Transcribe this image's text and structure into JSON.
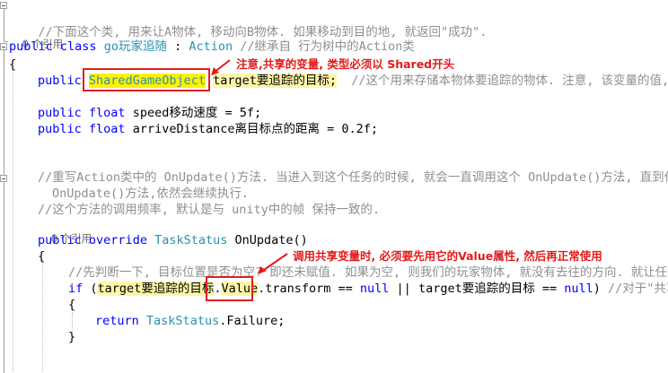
{
  "colors": {
    "keyword": "#0000ff",
    "type": "#2b91af",
    "comment": "#8f8f8f",
    "annotation": "#e21b1b",
    "highlight": "#fff6a8"
  },
  "code": {
    "l1_comment": "//下面这个类, 用来让A物体, 移动向B物体. 如果移动到目的地, 就返回\"成功\".",
    "l2_refs": "0 个引用",
    "l3_public": "public",
    "l3_class": "class",
    "l3_name": "go玩家追随",
    "l3_colon": " : ",
    "l3_base": "Action",
    "l3_comment": "//继承自 行为树中的Action类",
    "l4_brace": "{",
    "l5_public": "public",
    "l5_type": "SharedGameObject",
    "l5_var": "target要追踪的目标;",
    "l5_comment": "//这个用来存储本物体要追踪的物体. 注意, 该变量的值, 会",
    "l6_public": "public",
    "l6_float": "float",
    "l6_rest": "speed移动速度 = 5f;",
    "l7_public": "public",
    "l7_float": "float",
    "l7_rest": "arriveDistance离目标点的距离 = 0.2f;",
    "l8_comment": "//重写Action类中的 OnUpdate()方法. 当进入到这个任务的时候, 就会一直调用这个 OnUpdate()方法, 直到任务",
    "l9_comment": "OnUpdate()方法,依然会继续执行.",
    "l10_comment": "//这个方法的调用频率, 默认是与 unity中的帧 保持一致的.",
    "l11_refs": "0 个引用",
    "l12_public": "public",
    "l12_override": "override",
    "l12_type": "TaskStatus",
    "l12_rest": "OnUpdate()",
    "l13_brace": "{",
    "l14_comment": "//先判断一下, 目标位置是否为空? 即还未赋值. 如果为空, 则我们的玩家物体, 就没有去往的方向. 就让任务直",
    "l15_if": "if",
    "l15_paren": "(",
    "l15_target": "target要追踪的目标",
    "l15_dot": ".",
    "l15_value": "Value",
    "l15_transform": ".transform",
    "l15_eq": " == ",
    "l15_null": "null",
    "l15_or": " || ",
    "l15_target2": "target要追踪的目标",
    "l15_eq2": " == ",
    "l15_null2": "null",
    "l15_close": ")",
    "l15_comment": "//对于\"共享的",
    "l16_brace": "{",
    "l17_return": "return",
    "l17_type": "TaskStatus",
    "l17_rest": ".Failure;",
    "l18_brace": "}"
  },
  "annotations": {
    "a1": "注意,共享的变量, 类型必须以 Shared开头",
    "a2": "调用共享变量时, 必须要先用它的Value属性, 然后再正常使用"
  }
}
